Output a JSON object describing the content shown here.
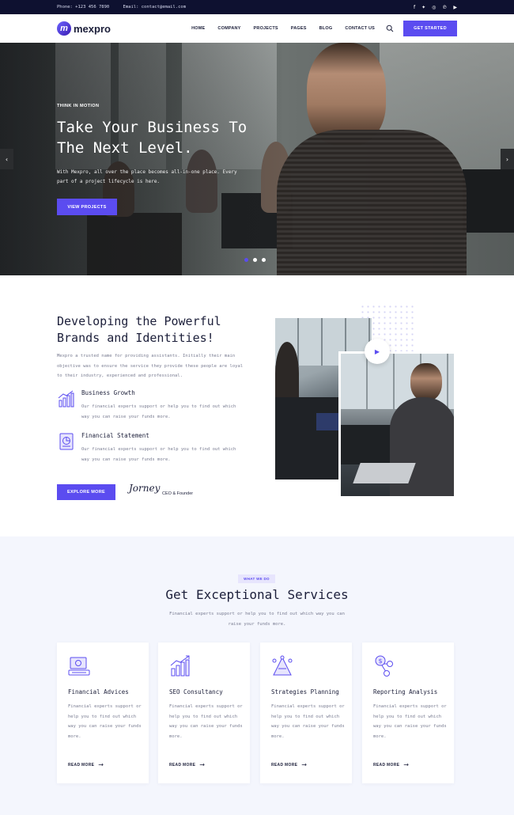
{
  "topbar": {
    "phone": "Phone: +123 456 7890",
    "email": "Email: contact@email.com",
    "social": [
      "facebook-icon",
      "twitter-icon",
      "instagram-icon",
      "pinterest-icon",
      "youtube-icon"
    ]
  },
  "header": {
    "logo_text": "mexpro",
    "logo_mark": "m",
    "nav": [
      "HOME",
      "COMPANY",
      "PROJECTS",
      "PAGES",
      "BLOG",
      "CONTACT US"
    ],
    "cta": "GET STARTED"
  },
  "hero": {
    "eyebrow": "THINK IN MOTION",
    "title": "Take Your Business To The Next Level.",
    "description": "With Mexpro, all over the place becomes all-in-one place. Every part of a project lifecycle is here.",
    "button": "VIEW PROJECTS",
    "prev": "‹",
    "next": "›"
  },
  "about": {
    "title": "Developing the Powerful Brands and Identities!",
    "description": "Mexpro a trusted name for providing assistants. Initially their main objective was to ensure the service they provide these people are loyal to their industry, experienced and professional.",
    "features": [
      {
        "title": "Business Growth",
        "text": "Our financial experts support or help you to find out which way you can raise your funds more."
      },
      {
        "title": "Financial Statement",
        "text": "Our financial experts support or help you to find out which way you can raise your funds more."
      }
    ],
    "button": "EXPLORE MORE",
    "signature": "Jorney",
    "role": "CEO & Founder"
  },
  "services": {
    "badge": "WHAT WE DO",
    "title": "Get Exceptional Services",
    "description": "Financial experts support or help you to find out which way you can raise your funds more.",
    "cards": [
      {
        "title": "Financial Advices",
        "text": "Financial experts support or help you to find out which way you can raise your funds more.",
        "more": "READ MORE"
      },
      {
        "title": "SEO Consultancy",
        "text": "Financial experts support or help you to find out which way you can raise your funds more.",
        "more": "READ MORE"
      },
      {
        "title": "Strategies Planning",
        "text": "Financial experts support or help you to find out which way you can raise your funds more.",
        "more": "READ MORE"
      },
      {
        "title": "Reporting Analysis",
        "text": "Financial experts support or help you to find out which way you can raise your funds more.",
        "more": "READ MORE"
      }
    ]
  },
  "colors": {
    "accent": "#5b4cf0",
    "topbar": "#0e1130",
    "section_bg": "#f4f6fd"
  }
}
